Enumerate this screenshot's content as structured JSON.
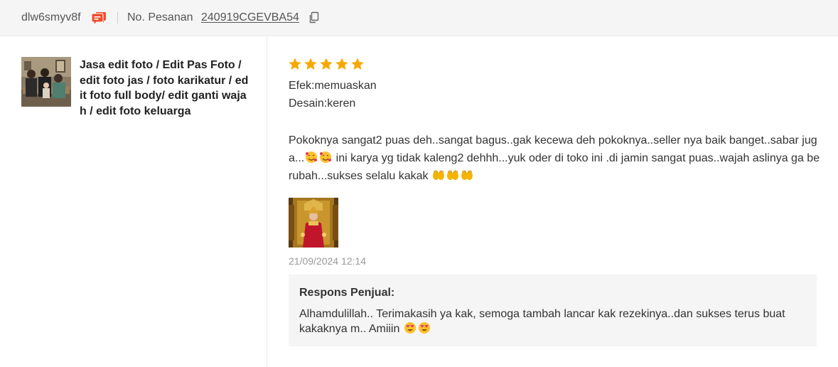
{
  "header": {
    "username": "dlw6smyv8f",
    "chat_icon": "chat-bubble-icon",
    "order_label": "No. Pesanan",
    "order_number": "240919CGEVBA54",
    "copy_icon": "copy-icon"
  },
  "product": {
    "name": "Jasa edit foto / Edit Pas Foto / edit foto jas / foto karikatur / edit foto full body/ edit ganti wajah / edit foto keluarga",
    "image": "family-portrait-thumbnail"
  },
  "review": {
    "rating": 5,
    "rating_max": 5,
    "star_color": "#f6a700",
    "attributes": [
      {
        "text": "Efek:memuaskan"
      },
      {
        "text": "Desain:keren"
      }
    ],
    "text_part1": "Pokoknya sangat2 puas deh..sangat bagus..gak kecewa deh pokoknya..seller nya baik banget..sabar juga...",
    "text_part2": " ini karya yg tidak kaleng2 dehhh...yuk oder di toko ini .di jamin sangat puas..wajah aslinya ga berubah...sukses selalu kakak ",
    "emoji_a": "smiling-face-with-hearts",
    "emoji_b": "open-hands",
    "photo": "traditional-costume-portrait",
    "timestamp": "21/09/2024 12:14"
  },
  "seller_response": {
    "title": "Respons Penjual:",
    "text": "Alhamdulillah.. Terimakasih ya kak, semoga tambah lancar kak rezekinya..dan sukses terus buat kakaknya m.. Amiiin ",
    "emoji": "smiling-face-with-heart-eyes"
  }
}
